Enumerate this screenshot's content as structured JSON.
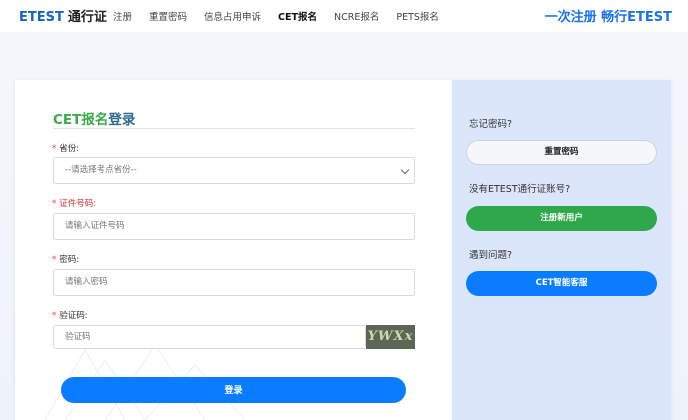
{
  "header": {
    "brand_en": "ETEST",
    "brand_cn": "通行证",
    "nav": [
      {
        "label": "注册"
      },
      {
        "label": "重置密码"
      },
      {
        "label": "信息占用申诉"
      },
      {
        "label": "CET报名"
      },
      {
        "label": "NCRE报名"
      },
      {
        "label": "PETS报名"
      }
    ],
    "active_nav": "CET报名",
    "slogan": "一次注册 畅行ETEST"
  },
  "login": {
    "title_part1": "CET报名",
    "title_part2": "登录",
    "province": {
      "required": "*",
      "label": "省份:",
      "selected": "--请选择考点省份--"
    },
    "id_number": {
      "required": "*",
      "label": "证件号码:",
      "placeholder": "请输入证件号码"
    },
    "password": {
      "required": "*",
      "label": "密码:",
      "placeholder": "请输入密码"
    },
    "captcha": {
      "required": "*",
      "label": "验证码:",
      "placeholder": "验证码",
      "image_text": "YWXx"
    },
    "submit_label": "登录"
  },
  "sidebar": {
    "forgot_label": "忘记密码?",
    "reset_button": "重置密码",
    "no_account_label": "没有ETEST通行证账号?",
    "register_button": "注册新用户",
    "problem_label": "遇到问题?",
    "support_button": "CET智能客服"
  },
  "colors": {
    "primary_blue": "#0a7cff",
    "green": "#2ea84a",
    "title_green": "#3caa4a",
    "sidebar_bg": "#dbe6fb"
  }
}
